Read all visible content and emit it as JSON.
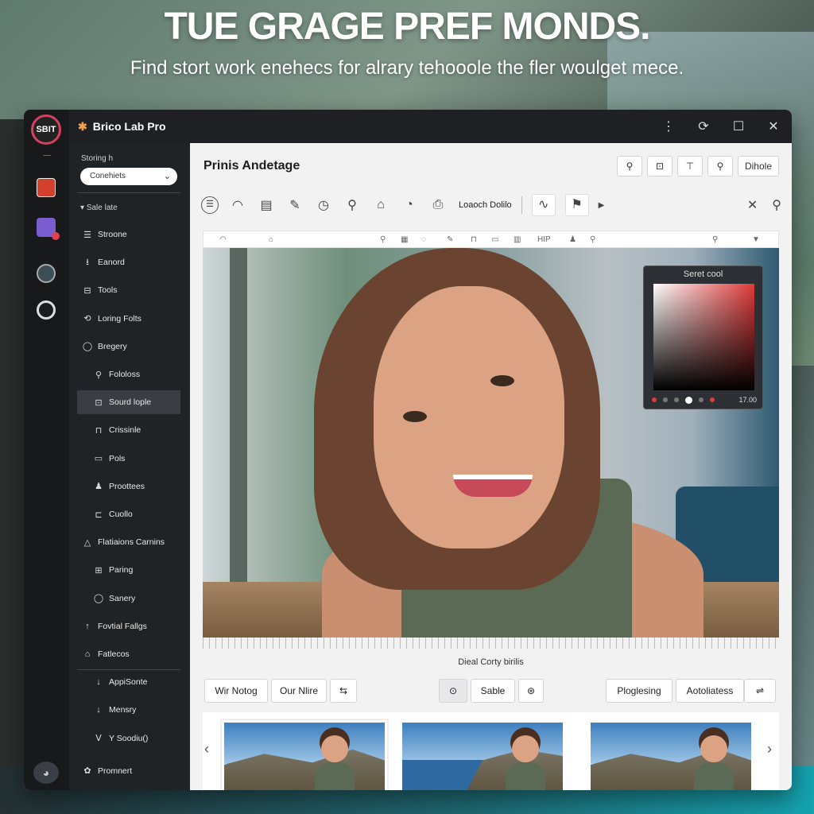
{
  "hero": {
    "headline": "TUE GRAGE PREF MONDS.",
    "subline": "Find stort work enehecs for alrary tehooole the fler woulget mece."
  },
  "window": {
    "app_title": "Brico Lab Pro",
    "logo_text": "SBIT",
    "controls": [
      "⋮",
      "⟳",
      "☐",
      "✕"
    ]
  },
  "sidebar": {
    "sort_label": "Storing h",
    "sort_value": "Conehiets",
    "section": "Sale late",
    "items": [
      {
        "label": "Stroone",
        "icon": "☰",
        "level": 1
      },
      {
        "label": "Eanord",
        "icon": "⭳",
        "level": 1
      },
      {
        "label": "Tools",
        "icon": "⊟",
        "level": 1
      },
      {
        "label": "Loring Folts",
        "icon": "⟲",
        "level": 1
      },
      {
        "label": "Bregery",
        "icon": "◯",
        "level": 1
      },
      {
        "label": "Fololoss",
        "icon": "⚲",
        "level": 2
      },
      {
        "label": "Sourd lople",
        "icon": "⊡",
        "level": 2,
        "selected": true
      },
      {
        "label": "Crissinle",
        "icon": "⊓",
        "level": 2
      },
      {
        "label": "Pols",
        "icon": "▭",
        "level": 2
      },
      {
        "label": "Proottees",
        "icon": "♟",
        "level": 2
      },
      {
        "label": "Cuollo",
        "icon": "⊏",
        "level": 2
      },
      {
        "label": "Flatiaions Carnins",
        "icon": "△",
        "level": 1
      },
      {
        "label": "Paring",
        "icon": "⊞",
        "level": 2
      },
      {
        "label": "Sanery",
        "icon": "◯",
        "level": 2
      },
      {
        "label": "Fovtial Fallgs",
        "icon": "↑",
        "level": 1
      },
      {
        "label": "Fatlecos",
        "icon": "⌂",
        "level": 1
      },
      {
        "label": "AppiSonte",
        "icon": "↓",
        "level": 2
      },
      {
        "label": "Mensry",
        "icon": "↓",
        "level": 2
      },
      {
        "label": "Y Soodiu()",
        "icon": "Ⅴ",
        "level": 2
      },
      {
        "label": "Promnert",
        "icon": "✿",
        "level": 1
      }
    ]
  },
  "main": {
    "title": "Prinis Andetage",
    "top_buttons": [
      "⚲",
      "⊡",
      "⊤",
      "⚲",
      "Dihole"
    ],
    "load_label": "Loaoch Dolilo",
    "ruler_text": "HIP",
    "picker_title": "Seret cool",
    "picker_value": "17.00",
    "caption": "Dieal Corty birilis",
    "bottom_buttons": {
      "b1": "Wir Notog",
      "b2": "Our Nlire",
      "b3": "⇆",
      "b4": "⊙",
      "b5": "Sable",
      "b6": "⊛",
      "b7": "Ploglesing",
      "b8": "Aotoliatess",
      "b9": "⇌"
    }
  }
}
